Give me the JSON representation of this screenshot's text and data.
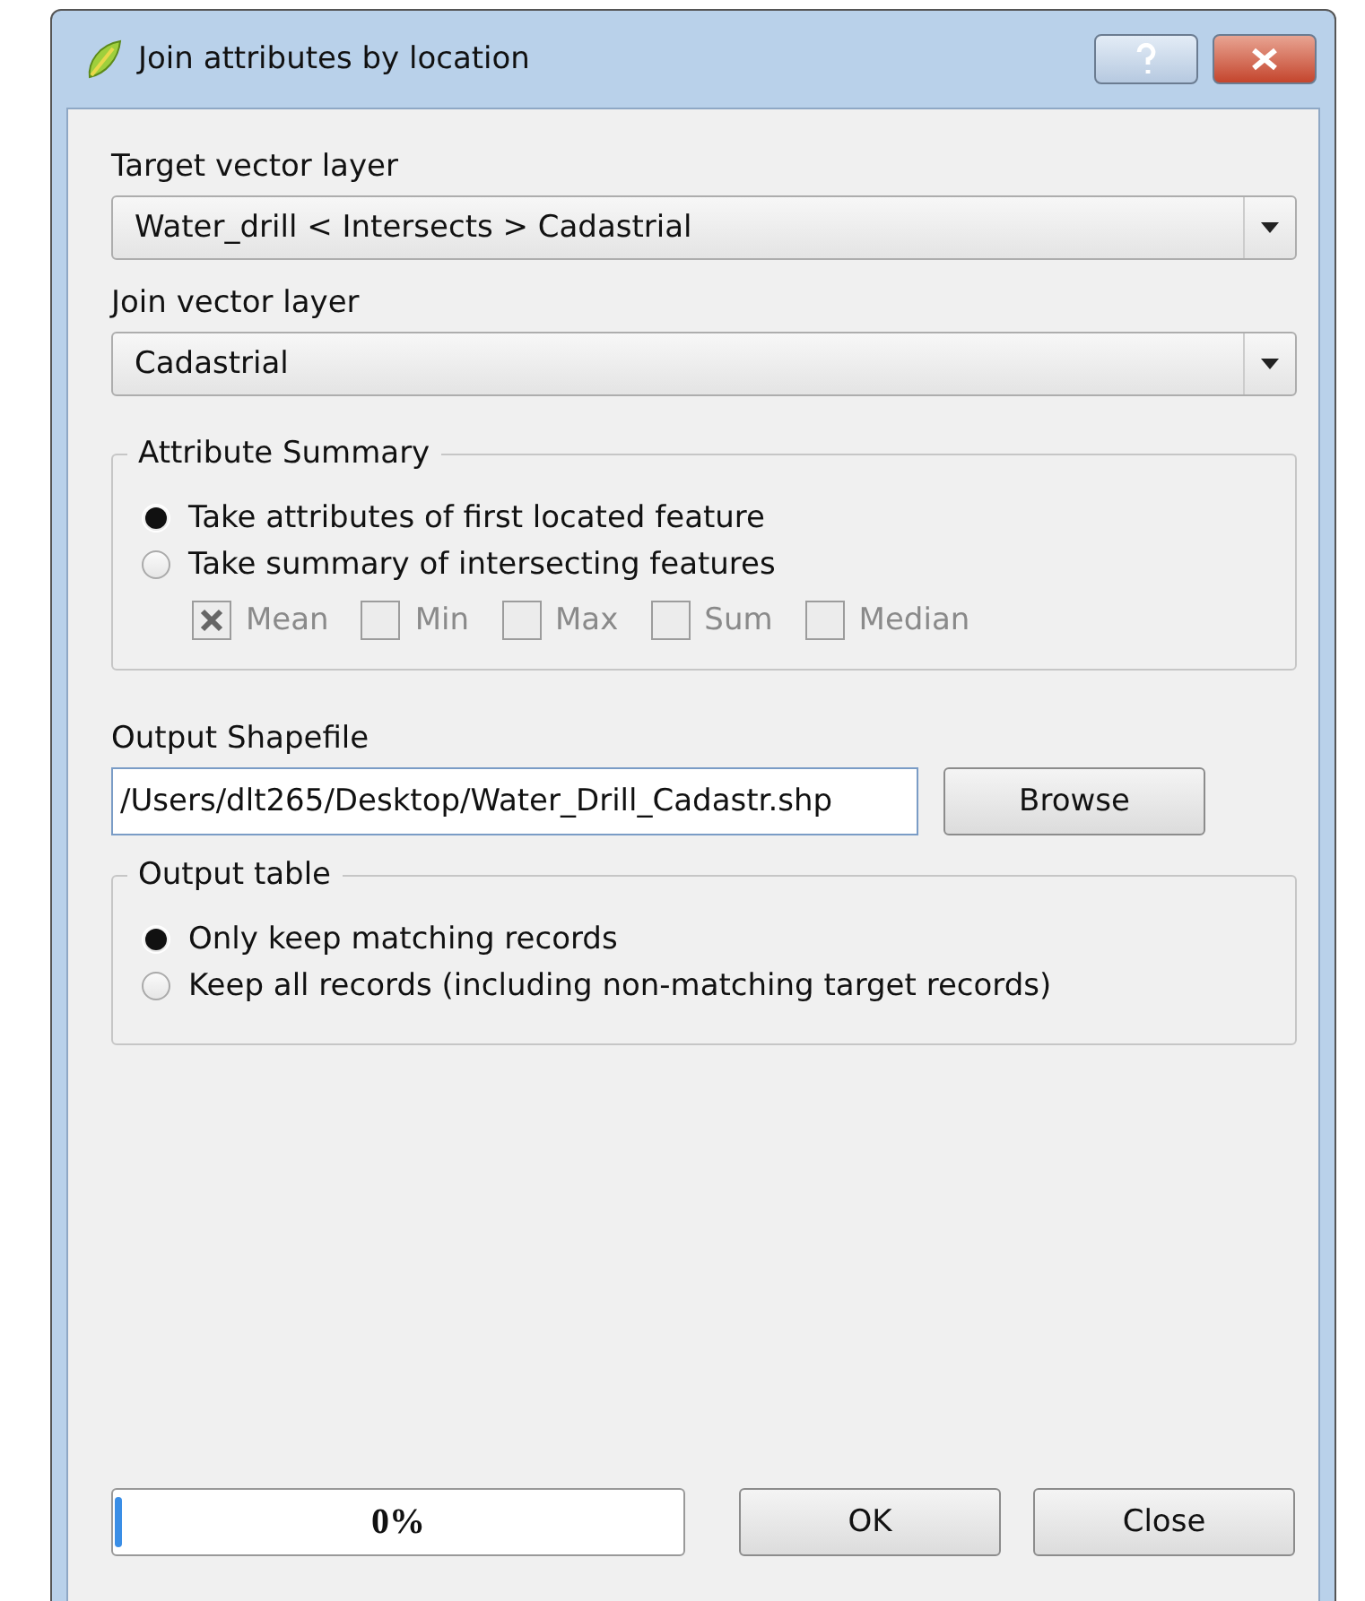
{
  "window": {
    "title": "Join attributes by location"
  },
  "target_layer": {
    "label": "Target vector layer",
    "value": "Water_drill < Intersects > Cadastrial"
  },
  "join_layer": {
    "label": "Join vector layer",
    "value": "Cadastrial"
  },
  "attribute_summary": {
    "title": "Attribute Summary",
    "options": [
      {
        "label": "Take attributes of first located feature",
        "selected": true
      },
      {
        "label": "Take summary of intersecting features",
        "selected": false
      }
    ],
    "statistics": [
      {
        "label": "Mean",
        "checked": true,
        "disabled": true
      },
      {
        "label": "Min",
        "checked": false,
        "disabled": true
      },
      {
        "label": "Max",
        "checked": false,
        "disabled": true
      },
      {
        "label": "Sum",
        "checked": false,
        "disabled": true
      },
      {
        "label": "Median",
        "checked": false,
        "disabled": true
      }
    ]
  },
  "output_shapefile": {
    "label": "Output Shapefile",
    "value": "/Users/dlt265/Desktop/Water_Drill_Cadastr.shp",
    "button": "Browse"
  },
  "output_table": {
    "title": "Output table",
    "options": [
      {
        "label": "Only keep matching records",
        "selected": true
      },
      {
        "label": "Keep all records (including non-matching target records)",
        "selected": false
      }
    ]
  },
  "progress": {
    "level": 0,
    "reading": "0%"
  },
  "buttons": [
    "OK",
    "Close"
  ]
}
